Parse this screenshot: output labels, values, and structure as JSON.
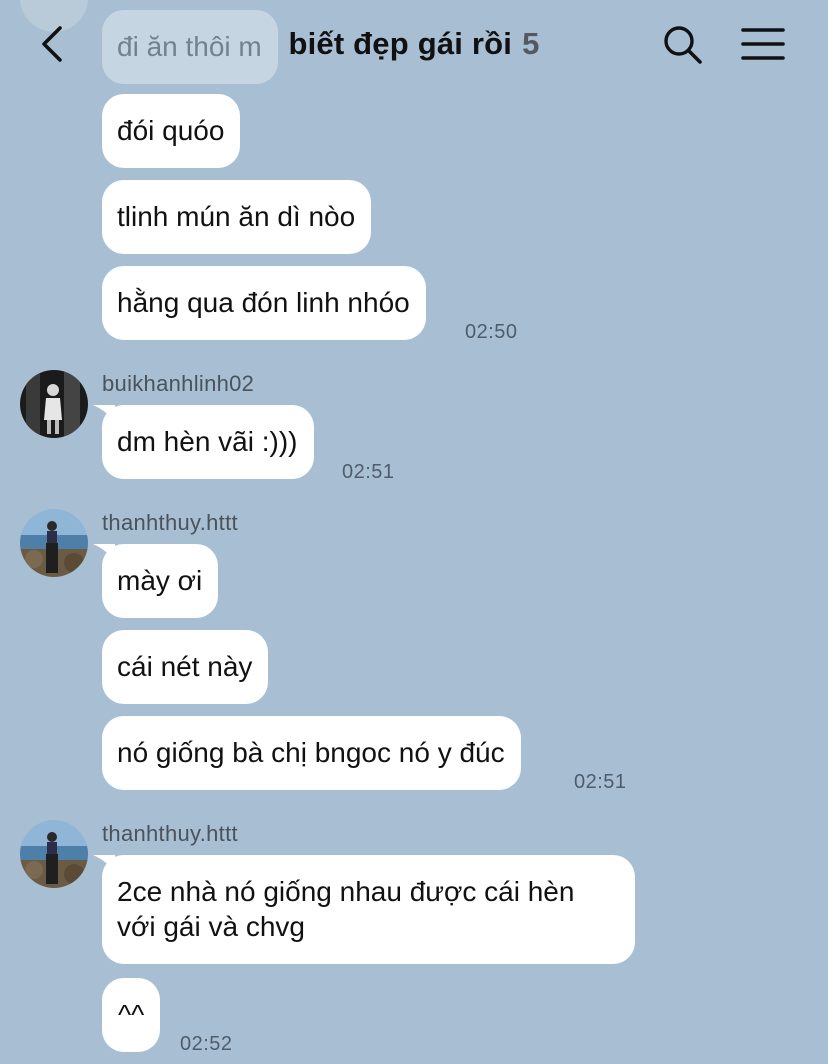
{
  "header": {
    "title": "biết đẹp gái rồi",
    "member_count": "5",
    "back_icon": "chevron-left-icon",
    "search_icon": "search-icon",
    "menu_icon": "hamburger-menu-icon"
  },
  "colors": {
    "background": "#a8bfd3",
    "bubble": "#ffffff",
    "timestamp": "#4f5d6b"
  },
  "messages": [
    {
      "text": "đi ăn thôi m"
    },
    {
      "text": "đói quóo"
    },
    {
      "text": "tlinh mún ăn dì nòo"
    },
    {
      "text": "hằng qua đón linh nhóo",
      "time": "02:50"
    },
    {
      "sender": "buikhanhlinh02",
      "text": "dm hèn vãi :)))",
      "time": "02:51"
    },
    {
      "sender": "thanhthuy.httt",
      "text": "mày ơi"
    },
    {
      "text": "cái nét này"
    },
    {
      "text": "nó giống bà chị bngoc nó y đúc",
      "time": "02:51"
    },
    {
      "sender": "thanhthuy.httt",
      "text": "2ce nhà nó giống nhau được cái hèn với gái và chvg"
    },
    {
      "text": "^^",
      "time": "02:52"
    }
  ]
}
